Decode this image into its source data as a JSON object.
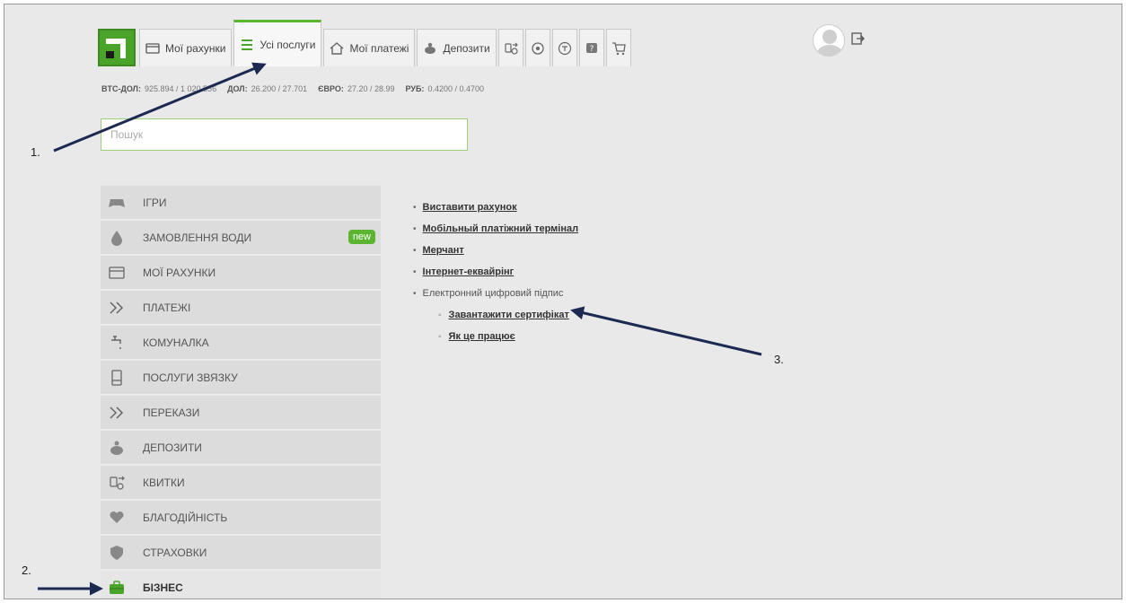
{
  "nav": {
    "tabs": [
      {
        "label": "Мої рахунки",
        "icon": "card-icon"
      },
      {
        "label": "Усі послуги",
        "icon": "list-icon",
        "active": true
      },
      {
        "label": "Мої платежі",
        "icon": "house-icon"
      },
      {
        "label": "Депозити",
        "icon": "piggy-icon"
      }
    ],
    "icon_tabs": [
      "tickets-icon",
      "settings-icon",
      "clock-icon",
      "help-icon",
      "cart-icon"
    ]
  },
  "rates": [
    {
      "name": "BTC-ДОЛ:",
      "value": "925.894 / 1 020.556"
    },
    {
      "name": "ДОЛ:",
      "value": "26.200 / 27.701"
    },
    {
      "name": "ЄВРО:",
      "value": "27.20 / 28.99"
    },
    {
      "name": "РУБ:",
      "value": "0.4200 / 0.4700"
    }
  ],
  "search": {
    "placeholder": "Пошук"
  },
  "sidebar": {
    "items": [
      {
        "label": "ІГРИ",
        "icon": "gamepad-icon"
      },
      {
        "label": "ЗАМОВЛЕННЯ ВОДИ",
        "icon": "water-drop-icon",
        "badge": "new"
      },
      {
        "label": "МОЇ РАХУНКИ",
        "icon": "card-icon"
      },
      {
        "label": "ПЛАТЕЖІ",
        "icon": "double-chevron-icon"
      },
      {
        "label": "КОМУНАЛКА",
        "icon": "faucet-icon"
      },
      {
        "label": "ПОСЛУГИ ЗВЯЗКУ",
        "icon": "phone-icon"
      },
      {
        "label": "ПЕРЕКАЗИ",
        "icon": "double-chevron-icon"
      },
      {
        "label": "ДЕПОЗИТИ",
        "icon": "piggy-icon"
      },
      {
        "label": "КВИТКИ",
        "icon": "tickets-icon"
      },
      {
        "label": "БЛАГОДІЙНІСТЬ",
        "icon": "heart-hand-icon"
      },
      {
        "label": "СТРАХОВКИ",
        "icon": "shield-icon"
      },
      {
        "label": "БІЗНЕС",
        "icon": "briefcase-icon",
        "active": true
      }
    ]
  },
  "links": {
    "items": [
      "Виставити рахунок",
      "Мобільный платіжний термінал",
      "Мерчант",
      "Інтернет-еквайрінг"
    ],
    "group_label": "Електронний цифровий підпис",
    "sub_items": [
      "Завантажити сертифікат",
      "Як це працює"
    ]
  },
  "annotations": {
    "one": "1.",
    "two": "2.",
    "three": "3."
  },
  "colors": {
    "accent": "#5cb531",
    "arrow": "#1c2a52"
  }
}
